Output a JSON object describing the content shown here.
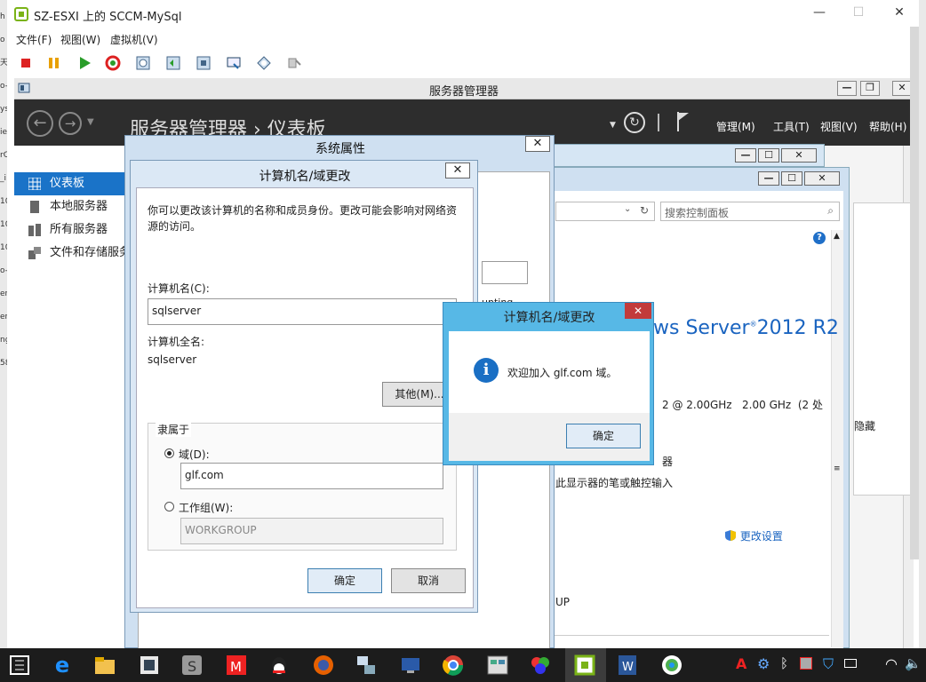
{
  "vmrc": {
    "title": "SZ-ESXI 上的 SCCM-MySql",
    "menu": [
      "文件(F)",
      "视图(W)",
      "虚拟机(V)"
    ]
  },
  "host_strip": [
    "h",
    "o",
    "天",
    "o-",
    "ys",
    "ie",
    "rC",
    "_i",
    "10",
    "10",
    "10",
    "o-1",
    "er",
    "er",
    "ng",
    "58"
  ],
  "server_manager": {
    "window_title": "服务器管理器",
    "breadcrumb": "服务器管理器 › 仪表板",
    "menus": [
      "管理(M)",
      "工具(T)",
      "视图(V)",
      "帮助(H)"
    ],
    "sidebar": [
      {
        "label": "仪表板",
        "active": true
      },
      {
        "label": "本地服务器",
        "active": false
      },
      {
        "label": "所有服务器",
        "active": false
      },
      {
        "label": "文件和存储服务",
        "active": false
      }
    ]
  },
  "control_panel": {
    "search_placeholder": "搜索控制面板",
    "os_brand": "ws Server",
    "os_version": "2012 R2",
    "cpu_info": "2 @ 2.00GHz   2.00 GHz  (2 处",
    "line_processor": "器",
    "line_pen": "此显示器的笔或触控输入",
    "change_settings": "更改设置",
    "hide_label": "隐藏",
    "workgroup_frag": "UP",
    "partial_text": "unting"
  },
  "system_properties": {
    "title": "系统属性"
  },
  "computer_name_dialog": {
    "title": "计算机名/域更改",
    "description": "你可以更改该计算机的名称和成员身份。更改可能会影响对网络资源的访问。",
    "computer_name_label": "计算机名(C):",
    "computer_name_value": "sqlserver",
    "full_name_label": "计算机全名:",
    "full_name_value": "sqlserver",
    "other_button": "其他(M)...",
    "member_of_label": "隶属于",
    "domain_label": "域(D):",
    "domain_value": "glf.com",
    "workgroup_label": "工作组(W):",
    "workgroup_value": "WORKGROUP",
    "ok_button": "确定",
    "cancel_button": "取消"
  },
  "welcome_dialog": {
    "title": "计算机名/域更改",
    "message": "欢迎加入 glf.com 域。",
    "ok_button": "确定",
    "info_icon_glyph": "i"
  },
  "taskbar_icons": [
    "start",
    "ie",
    "explorer",
    "server-manager",
    "powershell",
    "app-m",
    "qq",
    "firefox",
    "network",
    "remote",
    "chrome",
    "app-grid",
    "photos",
    "vsphere",
    "word",
    "app-circle"
  ],
  "tray_icons": [
    "text-a",
    "network-tray",
    "bluetooth",
    "security",
    "shield",
    "battery",
    "wifi",
    "volume"
  ]
}
